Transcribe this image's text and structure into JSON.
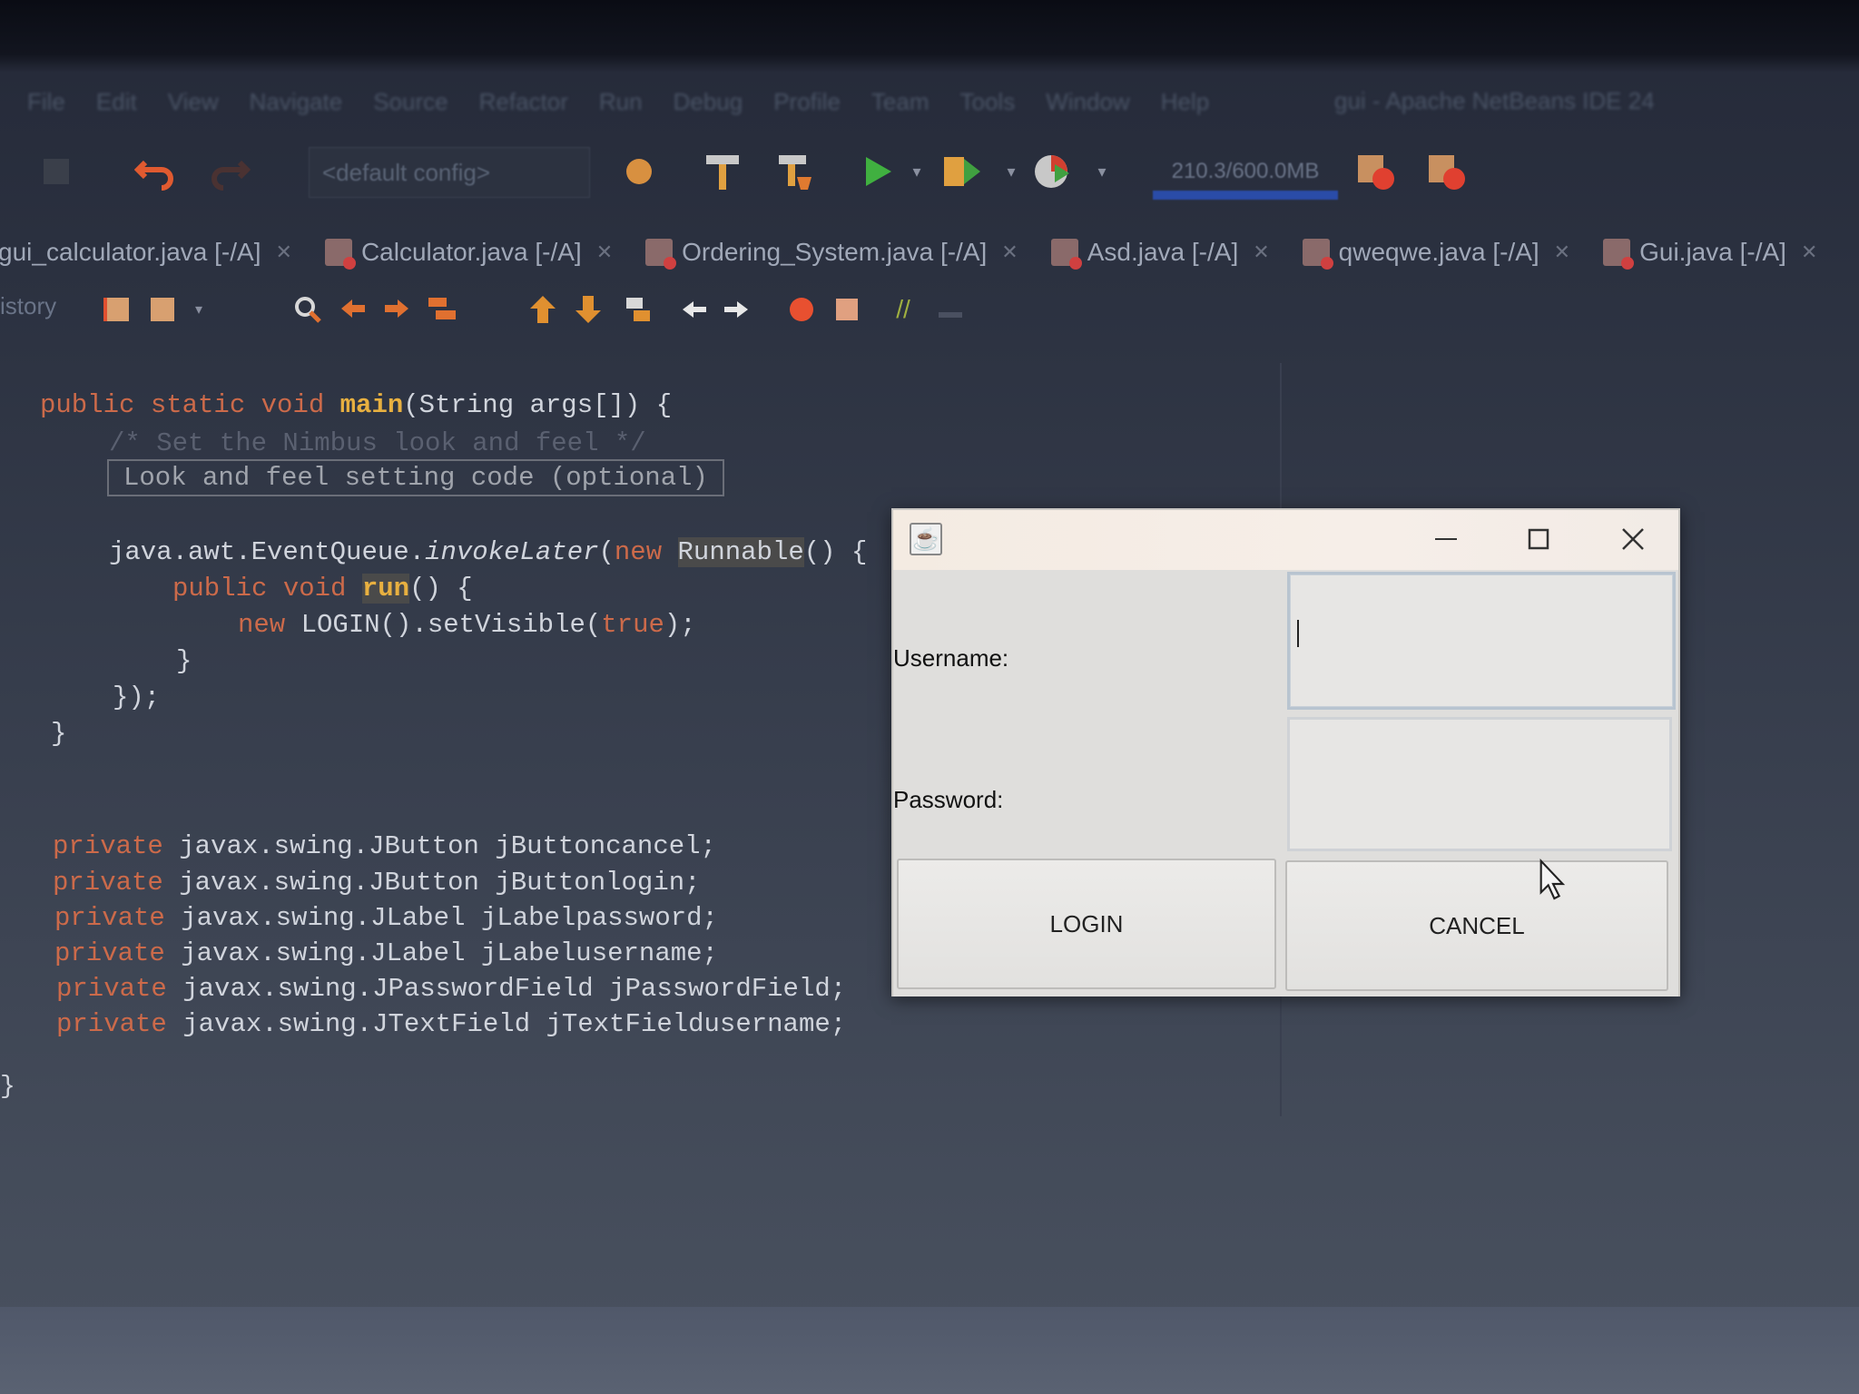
{
  "menu": {
    "items": [
      "File",
      "Edit",
      "View",
      "Navigate",
      "Source",
      "Refactor",
      "Run",
      "Debug",
      "Profile",
      "Team",
      "Tools",
      "Window",
      "Help"
    ],
    "title": "gui - Apache NetBeans IDE 24"
  },
  "toolbar": {
    "config": "<default config>",
    "memory": "210.3/600.0MB"
  },
  "tabs": [
    {
      "label": "gui_calculator.java [-/A]"
    },
    {
      "label": "Calculator.java [-/A]"
    },
    {
      "label": "Ordering_System.java [-/A]"
    },
    {
      "label": "Asd.java [-/A]"
    },
    {
      "label": "qweqwe.java [-/A]"
    },
    {
      "label": "Gui.java [-/A]"
    }
  ],
  "editor": {
    "history_label": "istory"
  },
  "code": {
    "l1_kw": "public static void ",
    "l1_fn": "main",
    "l1_rest": "(String args[]) {",
    "l2": "/* Set the Nimbus look and feel */",
    "l3": "Look and feel setting code (optional)",
    "l4_a": "java.awt.EventQueue.",
    "l4_b": "invokeLater",
    "l4_c": "(",
    "l4_d": "new ",
    "l4_e": "Runnable",
    "l4_f": "() {",
    "l5_kw": "public void ",
    "l5_fn": "run",
    "l5_rest": "() {",
    "l6_kw": "new ",
    "l6_a": "LOGIN().setVisible(",
    "l6_b": "true",
    "l6_c": ");",
    "l7": "}",
    "l8": "});",
    "l9": "}",
    "fields": [
      {
        "kw": "private ",
        "decl": "javax.swing.JButton jButtoncancel;"
      },
      {
        "kw": "private ",
        "decl": "javax.swing.JButton jButtonlogin;"
      },
      {
        "kw": "private ",
        "decl": "javax.swing.JLabel jLabelpassword;"
      },
      {
        "kw": "private ",
        "decl": "javax.swing.JLabel jLabelusername;"
      },
      {
        "kw": "private ",
        "decl": "javax.swing.JPasswordField jPasswordField;"
      },
      {
        "kw": "private ",
        "decl": "javax.swing.JTextField jTextFieldusername;"
      }
    ],
    "end": "}"
  },
  "dialog": {
    "icon": "java-icon",
    "username_label": "Username:",
    "username_value": "",
    "password_label": "Password:",
    "password_value": "",
    "login_label": "LOGIN",
    "cancel_label": "CANCEL"
  }
}
